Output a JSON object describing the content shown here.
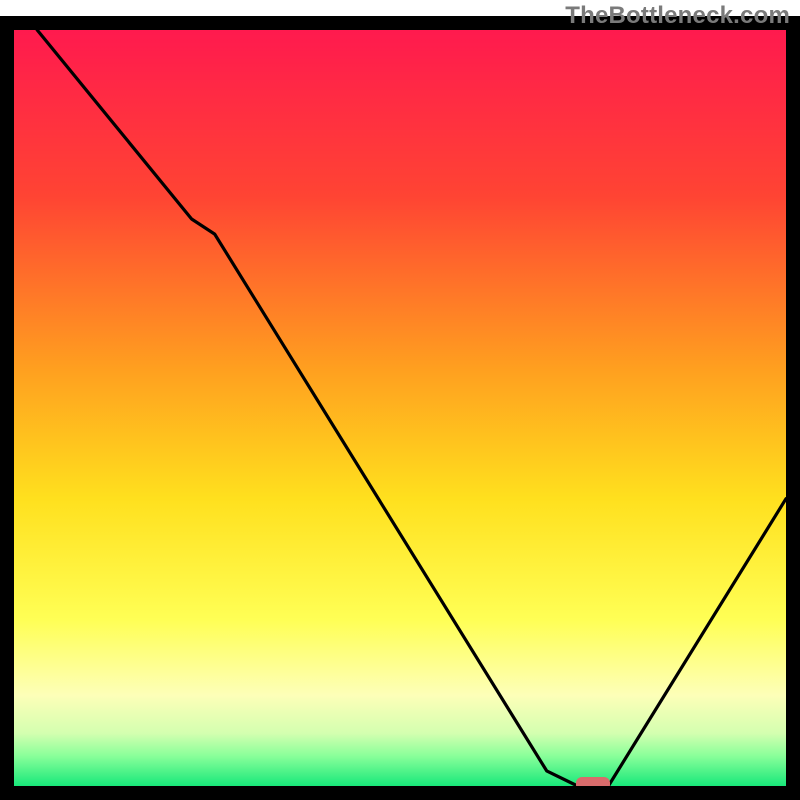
{
  "watermark": "TheBottleneck.com",
  "chart_data": {
    "type": "line",
    "title": "",
    "xlabel": "",
    "ylabel": "",
    "xlim": [
      0,
      100
    ],
    "ylim": [
      0,
      100
    ],
    "x": [
      3,
      23,
      26,
      69,
      73,
      77,
      100
    ],
    "values": [
      100,
      75,
      73,
      2,
      0,
      0,
      38
    ],
    "marker": {
      "x": 75,
      "y": 0
    },
    "gradient_stops": [
      {
        "offset": 0.0,
        "color": "#ff1a4e"
      },
      {
        "offset": 0.22,
        "color": "#ff4433"
      },
      {
        "offset": 0.45,
        "color": "#ffa01f"
      },
      {
        "offset": 0.62,
        "color": "#ffe01e"
      },
      {
        "offset": 0.78,
        "color": "#ffff55"
      },
      {
        "offset": 0.88,
        "color": "#fdffb8"
      },
      {
        "offset": 0.93,
        "color": "#d4ffb0"
      },
      {
        "offset": 0.96,
        "color": "#8aff9a"
      },
      {
        "offset": 1.0,
        "color": "#18e87a"
      }
    ],
    "marker_color": "#d86b6b",
    "frame_color": "#000000"
  }
}
